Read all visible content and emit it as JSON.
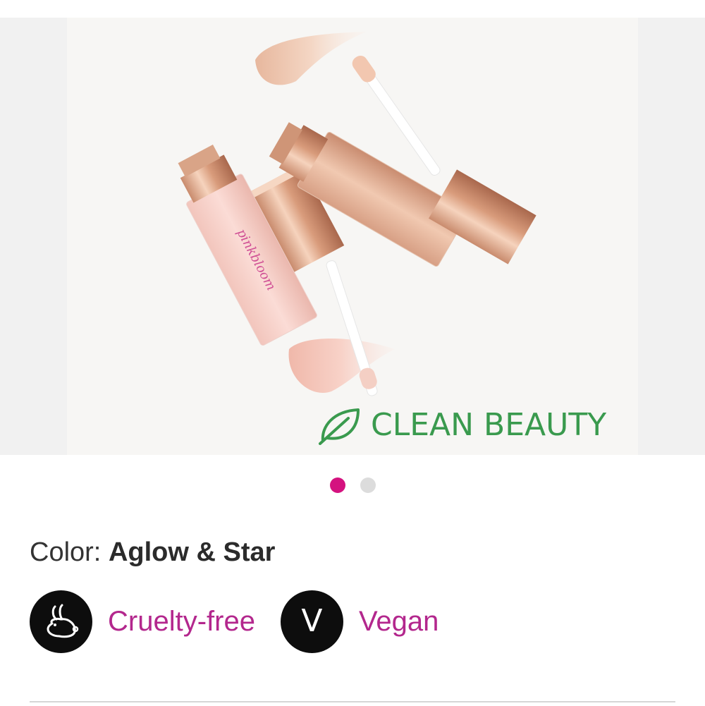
{
  "hero": {
    "badge_text": "CLEAN BEAUTY",
    "badge_icon": "leaf-icon",
    "product_brand_script": "pinkbloom"
  },
  "carousel": {
    "total": 2,
    "active_index": 0,
    "active_color": "#d4127f",
    "inactive_color": "#dcdcdc"
  },
  "color": {
    "label": "Color:",
    "value": "Aglow & Star"
  },
  "badges": [
    {
      "label": "Cruelty-free",
      "icon": "bunny-icon"
    },
    {
      "label": "Vegan",
      "icon": "vegan-v-icon",
      "letter": "V"
    }
  ],
  "colors": {
    "accent_magenta": "#b3278d",
    "clean_green": "#3a9a4e",
    "badge_black": "#0d0d0d"
  }
}
